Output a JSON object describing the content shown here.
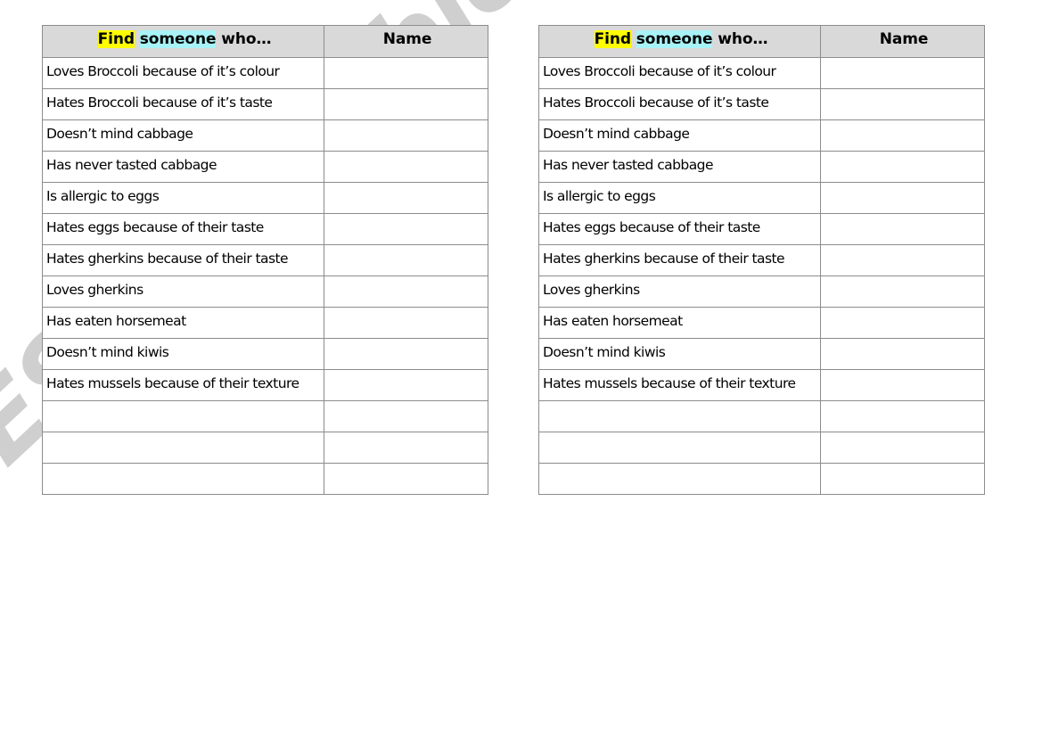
{
  "document": {
    "type": "worksheet",
    "watermark": "ESLprintables.com",
    "watermark_color": "#cfcfcf",
    "background_color": "#ffffff"
  },
  "table": {
    "header": {
      "prompt_parts": [
        {
          "text": "Find",
          "highlight": "#ffff00"
        },
        {
          "text": " ",
          "highlight": "none"
        },
        {
          "text": "someone",
          "highlight": "#a8f3f7"
        },
        {
          "text": " who…",
          "highlight": "none"
        }
      ],
      "prompt_full": "Find someone who…",
      "name_label": "Name",
      "background_color": "#d9d9d9"
    },
    "border_color": "#8c8c8c",
    "rows": [
      {
        "prompt": "Loves Broccoli because of it’s colour",
        "name": ""
      },
      {
        "prompt": "Hates Broccoli because of it’s taste",
        "name": ""
      },
      {
        "prompt": "Doesn’t mind cabbage",
        "name": ""
      },
      {
        "prompt": "Has never tasted cabbage",
        "name": ""
      },
      {
        "prompt": "Is allergic to eggs",
        "name": ""
      },
      {
        "prompt": "Hates eggs because of their taste",
        "name": ""
      },
      {
        "prompt": "Hates gherkins because of their taste",
        "name": ""
      },
      {
        "prompt": "Loves gherkins",
        "name": ""
      },
      {
        "prompt": "Has eaten horsemeat",
        "name": ""
      },
      {
        "prompt": "Doesn’t mind kiwis",
        "name": ""
      },
      {
        "prompt": "Hates mussels because of their texture",
        "name": ""
      },
      {
        "prompt": "",
        "name": ""
      },
      {
        "prompt": "",
        "name": ""
      },
      {
        "prompt": "",
        "name": ""
      }
    ]
  },
  "copies": [
    {
      "id": "left",
      "label": "left-copy"
    },
    {
      "id": "right",
      "label": "right-copy"
    }
  ]
}
